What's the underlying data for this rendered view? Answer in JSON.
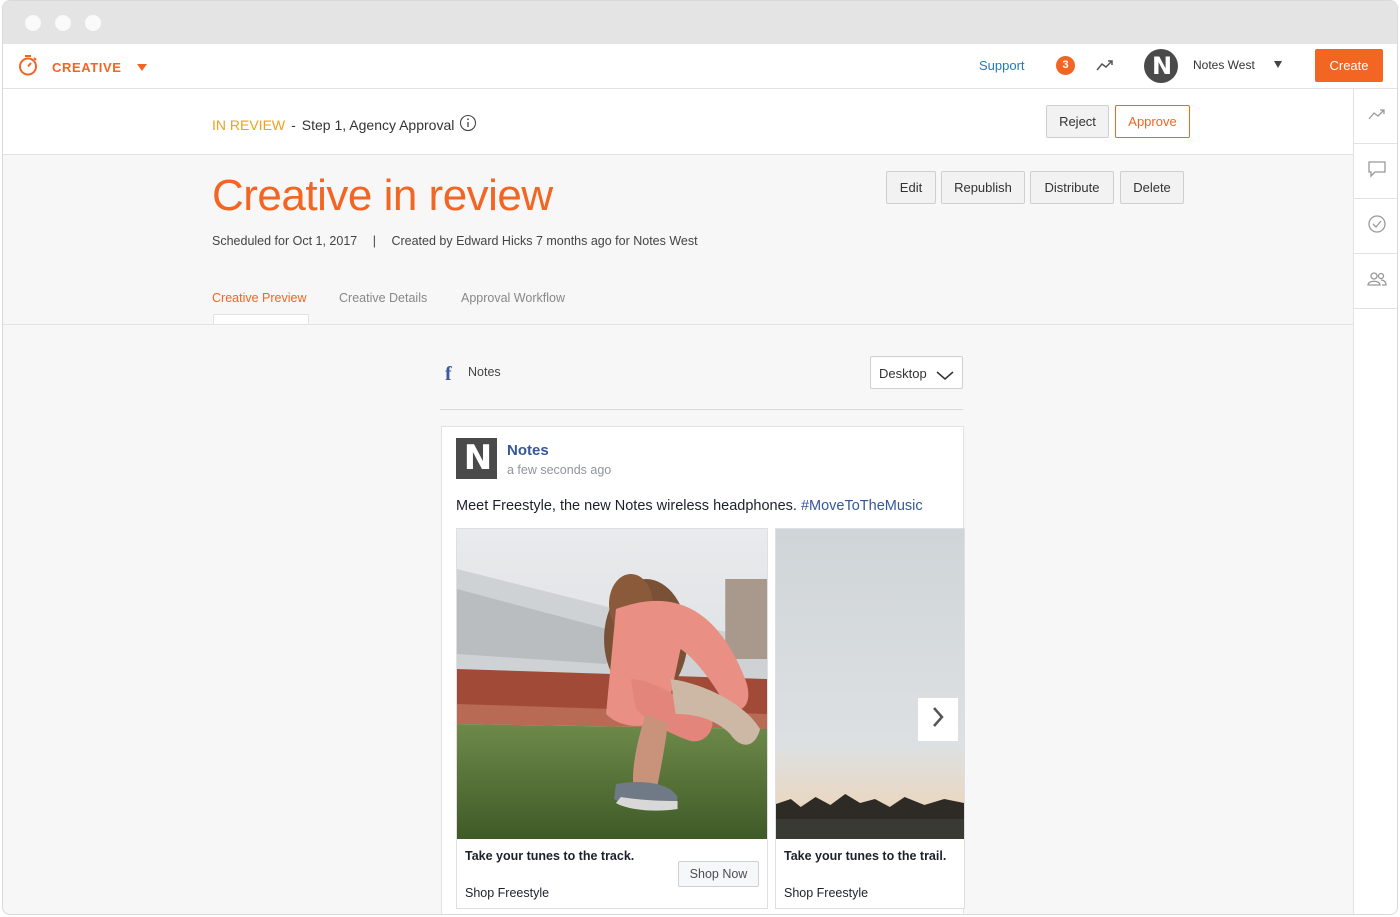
{
  "app": {
    "product_label": "CREATIVE",
    "icons": {
      "brand": "stopwatch-icon",
      "caret": "caret-down-icon"
    }
  },
  "navbar": {
    "support_label": "Support",
    "notification_count": "3",
    "account_avatar_letter": "N",
    "account_name": "Notes West",
    "create_label": "Create",
    "colors": {
      "accent": "#f26522",
      "link": "#1f7bbf"
    }
  },
  "right_rail": {
    "items": [
      {
        "icon": "trend-icon"
      },
      {
        "icon": "comment-icon"
      },
      {
        "icon": "check-circle-icon"
      },
      {
        "icon": "users-icon"
      }
    ]
  },
  "review_status": {
    "status": "IN REVIEW",
    "separator": "-",
    "step": "Step 1, Agency Approval",
    "reject_label": "Reject",
    "approve_label": "Approve",
    "status_color": "#f0a01e"
  },
  "creative": {
    "title": "Creative in review",
    "scheduled": "Scheduled for Oct 1, 2017",
    "separator": "|",
    "created": "Created by Edward Hicks 7 months ago for Notes West",
    "actions": {
      "edit": "Edit",
      "republish": "Republish",
      "distribute": "Distribute",
      "delete": "Delete"
    }
  },
  "tabs": [
    {
      "label": "Creative Preview",
      "active": true
    },
    {
      "label": "Creative Details",
      "active": false
    },
    {
      "label": "Approval Workflow",
      "active": false
    }
  ],
  "preview": {
    "network_icon": "facebook-icon",
    "network_glyph": "f",
    "page_label": "Notes",
    "device": "Desktop"
  },
  "post": {
    "avatar_letter": "N",
    "page_name": "Notes",
    "timestamp": "a few seconds ago",
    "text": "Meet Freestyle, the new Notes wireless headphones.",
    "hashtag": "#MoveToTheMusic",
    "cards": [
      {
        "headline": "Take your tunes to the track.",
        "subtitle": "Shop Freestyle",
        "cta": "Shop Now",
        "image": "athlete-tying-shoe-on-track-photo"
      },
      {
        "headline": "Take your tunes to the trail.",
        "subtitle": "Shop Freestyle",
        "image": "sky-over-treeline-photo"
      }
    ]
  }
}
